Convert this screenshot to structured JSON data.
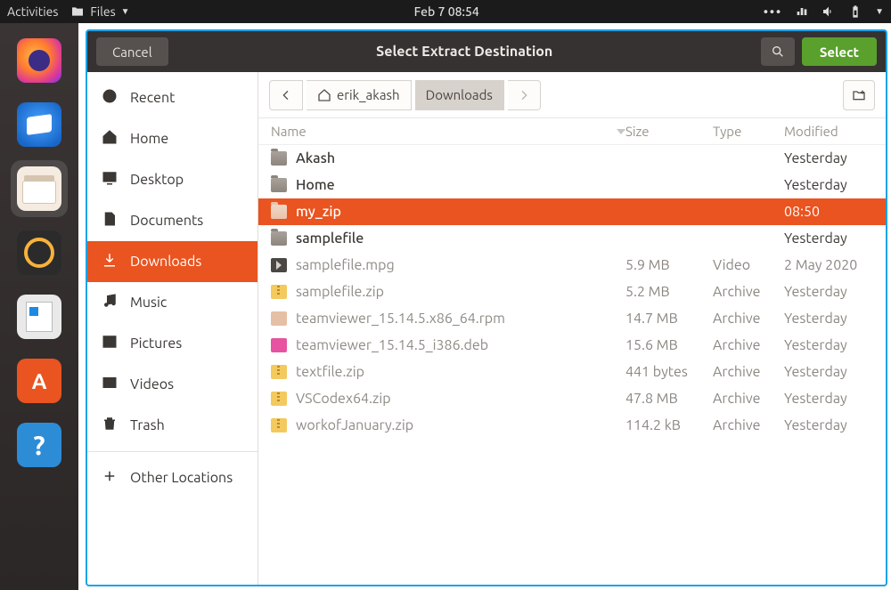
{
  "top_panel": {
    "activities": "Activities",
    "files_menu": "Files",
    "datetime": "Feb 7  08:54"
  },
  "dialog": {
    "cancel": "Cancel",
    "title": "Select Extract Destination",
    "select": "Select"
  },
  "sidebar": {
    "items": [
      {
        "label": "Recent",
        "icon": "clock-icon"
      },
      {
        "label": "Home",
        "icon": "home-icon"
      },
      {
        "label": "Desktop",
        "icon": "desktop-icon"
      },
      {
        "label": "Documents",
        "icon": "documents-icon"
      },
      {
        "label": "Downloads",
        "icon": "downloads-icon",
        "active": true
      },
      {
        "label": "Music",
        "icon": "music-icon"
      },
      {
        "label": "Pictures",
        "icon": "pictures-icon"
      },
      {
        "label": "Videos",
        "icon": "videos-icon"
      },
      {
        "label": "Trash",
        "icon": "trash-icon"
      }
    ],
    "other_locations": "Other Locations"
  },
  "pathbar": {
    "home_user": "erik_akash",
    "current": "Downloads"
  },
  "columns": {
    "name": "Name",
    "size": "Size",
    "type": "Type",
    "modified": "Modified"
  },
  "files": [
    {
      "name": "Akash",
      "icon": "folder",
      "size": "",
      "type": "",
      "modified": "Yesterday",
      "dim": false,
      "sel": false
    },
    {
      "name": "Home",
      "icon": "folder",
      "size": "",
      "type": "",
      "modified": "Yesterday",
      "dim": false,
      "sel": false
    },
    {
      "name": "my_zip",
      "icon": "folder",
      "size": "",
      "type": "",
      "modified": "08:50",
      "dim": false,
      "sel": true
    },
    {
      "name": "samplefile",
      "icon": "folder",
      "size": "",
      "type": "",
      "modified": "Yesterday",
      "dim": false,
      "sel": false
    },
    {
      "name": "samplefile.mpg",
      "icon": "video",
      "size": "5.9 MB",
      "type": "Video",
      "modified": "2 May 2020",
      "dim": true,
      "sel": false
    },
    {
      "name": "samplefile.zip",
      "icon": "zip",
      "size": "5.2 MB",
      "type": "Archive",
      "modified": "Yesterday",
      "dim": true,
      "sel": false
    },
    {
      "name": "teamviewer_15.14.5.x86_64.rpm",
      "icon": "rpm",
      "size": "14.7 MB",
      "type": "Archive",
      "modified": "Yesterday",
      "dim": true,
      "sel": false
    },
    {
      "name": "teamviewer_15.14.5_i386.deb",
      "icon": "deb",
      "size": "15.6 MB",
      "type": "Archive",
      "modified": "Yesterday",
      "dim": true,
      "sel": false
    },
    {
      "name": "textfile.zip",
      "icon": "zip",
      "size": "441 bytes",
      "type": "Archive",
      "modified": "Yesterday",
      "dim": true,
      "sel": false
    },
    {
      "name": "VSCodex64.zip",
      "icon": "zip",
      "size": "47.8 MB",
      "type": "Archive",
      "modified": "Yesterday",
      "dim": true,
      "sel": false
    },
    {
      "name": "workofJanuary.zip",
      "icon": "zip",
      "size": "114.2 kB",
      "type": "Archive",
      "modified": "Yesterday",
      "dim": true,
      "sel": false
    }
  ]
}
